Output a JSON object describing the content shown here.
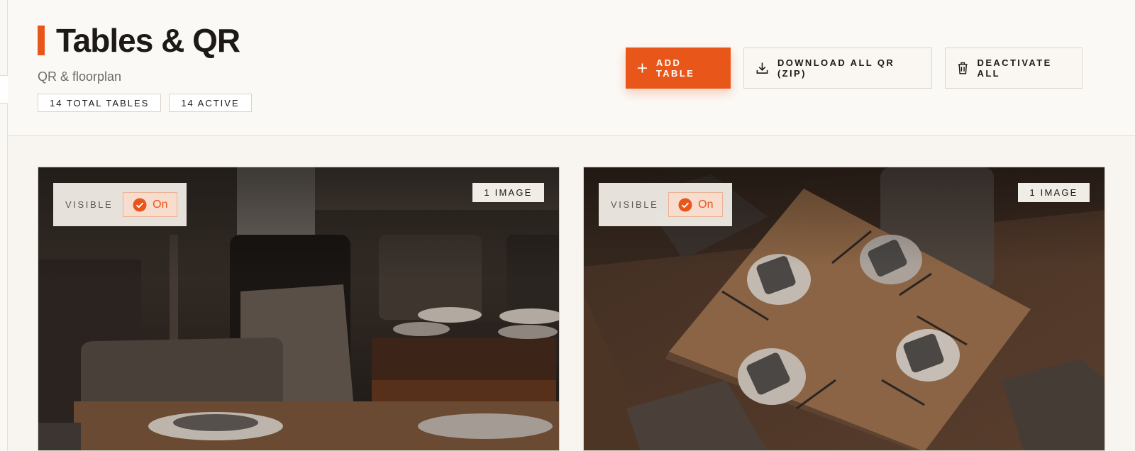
{
  "header": {
    "title": "Tables & QR",
    "subtitle": "QR & floorplan",
    "chips": [
      "14 TOTAL TABLES",
      "14 ACTIVE"
    ],
    "accent_color": "#e8561a"
  },
  "actions": {
    "add_label": "ADD TABLE",
    "download_label": "DOWNLOAD ALL QR (ZIP)",
    "deactivate_label": "DEACTIVATE ALL"
  },
  "icons": {
    "add": "plus-icon",
    "download": "download-icon",
    "deactivate": "trash-icon",
    "collapse": "chevron-left-icon",
    "check": "check-circle-icon"
  },
  "cards": [
    {
      "visible_label": "VISIBLE",
      "toggle_label": "On",
      "image_count": "1 IMAGE"
    },
    {
      "visible_label": "VISIBLE",
      "toggle_label": "On",
      "image_count": "1 IMAGE"
    }
  ]
}
